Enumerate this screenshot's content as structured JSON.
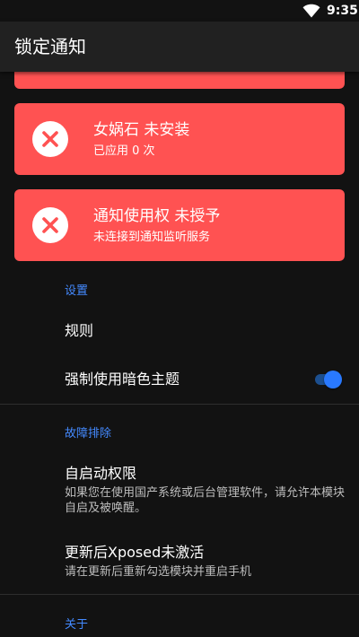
{
  "status_bar": {
    "time": "9:35",
    "wifi_icon": "wifi-icon"
  },
  "app_bar": {
    "title": "锁定通知"
  },
  "status_cards": [
    {
      "icon": "error-x-icon",
      "title": "女娲石 未安装",
      "subtitle": "已应用 0 次"
    },
    {
      "icon": "error-x-icon",
      "title": "通知使用权 未授予",
      "subtitle": "未连接到通知监听服务"
    }
  ],
  "settings": {
    "category": "设置",
    "rules_title": "规则",
    "dark_theme_title": "强制使用暗色主题",
    "dark_theme_enabled": true
  },
  "troubleshooting": {
    "category": "故障排除",
    "autostart_title": "自启动权限",
    "autostart_summary": "如果您在使用国产系统或后台管理软件，请允许本模块自启及被唤醒。",
    "xposed_title": "更新后Xposed未激活",
    "xposed_summary": "请在更新后重新勾选模块并重启手机"
  },
  "about": {
    "category": "关于"
  },
  "colors": {
    "card_error": "#ff5252",
    "accent": "#448aff",
    "background": "#121212",
    "app_bar": "#212121"
  }
}
